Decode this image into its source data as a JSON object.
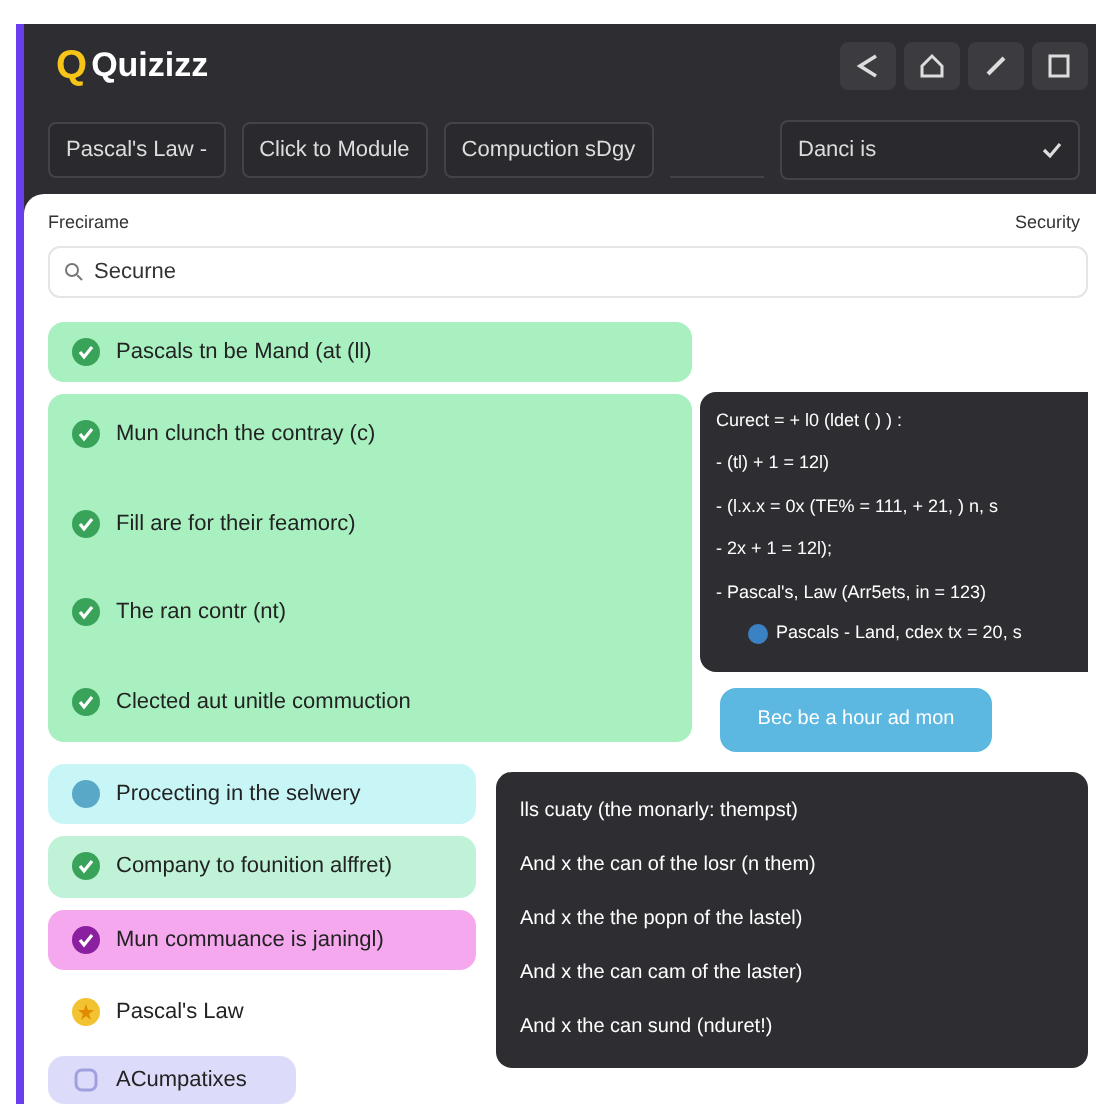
{
  "app": {
    "logo_letter": "Q",
    "name": "Quizizz"
  },
  "toolbar": {
    "pills": [
      "Pascal's Law -",
      "Click to Module",
      "Compuction sDgy"
    ],
    "select": "Danci is",
    "confirmed": true
  },
  "panel": {
    "label": "Frecirame",
    "label_right": "Security",
    "search": {
      "value": "Securne"
    }
  },
  "answer_blocks": [
    {
      "color": "#a8f0c0",
      "items": [
        {
          "kind": "correct",
          "label": "Pascals tn be Mand (at (ll)"
        }
      ]
    },
    {
      "color": "#a8f0c0",
      "items": [
        {
          "kind": "correct",
          "label": "Mun clunch the contray (c)"
        },
        {
          "kind": "correct",
          "label": "Fill are for their feamorc)"
        },
        {
          "kind": "correct",
          "label": "The ran contr (nt)"
        },
        {
          "kind": "correct",
          "label": "Clected aut unitle commuction"
        }
      ]
    }
  ],
  "code_panel": {
    "lines": [
      "Curect = + l0 (ldet ( ) ) :",
      "- (tl) + 1 = 12l)",
      "- (l.x.x = 0x (TE% = 111, + 21, ) n, s",
      "- 2x + 1 = 12l);",
      "- Pascal's, Law (Arr5ets, in = 123)"
    ],
    "sub_line": "Pascals - Land, cdex tx = 20, s"
  },
  "action_button": "Bec be a hour ad mon",
  "more_blocks": [
    {
      "color": "#c8f6f6",
      "items": [
        {
          "kind": "pending",
          "label": "Procecting in the selwery"
        }
      ]
    },
    {
      "color": "#c0f2d8",
      "items": [
        {
          "kind": "correct",
          "label": "Company to founition alffret)"
        }
      ]
    },
    {
      "color": "#f6a8ee",
      "items": [
        {
          "kind": "chosen",
          "label": "Mun commuance is janingl)"
        }
      ]
    },
    {
      "color": "#ffffff",
      "items": [
        {
          "kind": "starred",
          "label": "Pascal's Law"
        }
      ]
    },
    {
      "color": "#dcdcfa",
      "items": [
        {
          "kind": "option",
          "label": "ACumpatixes"
        }
      ]
    }
  ],
  "notes_panel": {
    "lines": [
      "lls cuaty (the monarly: thempst)",
      "And x the can of the losr (n them)",
      "And x the the popn of the lastel)",
      "And x the can cam of the laster)",
      "And x the can sund (nduret!)"
    ]
  }
}
